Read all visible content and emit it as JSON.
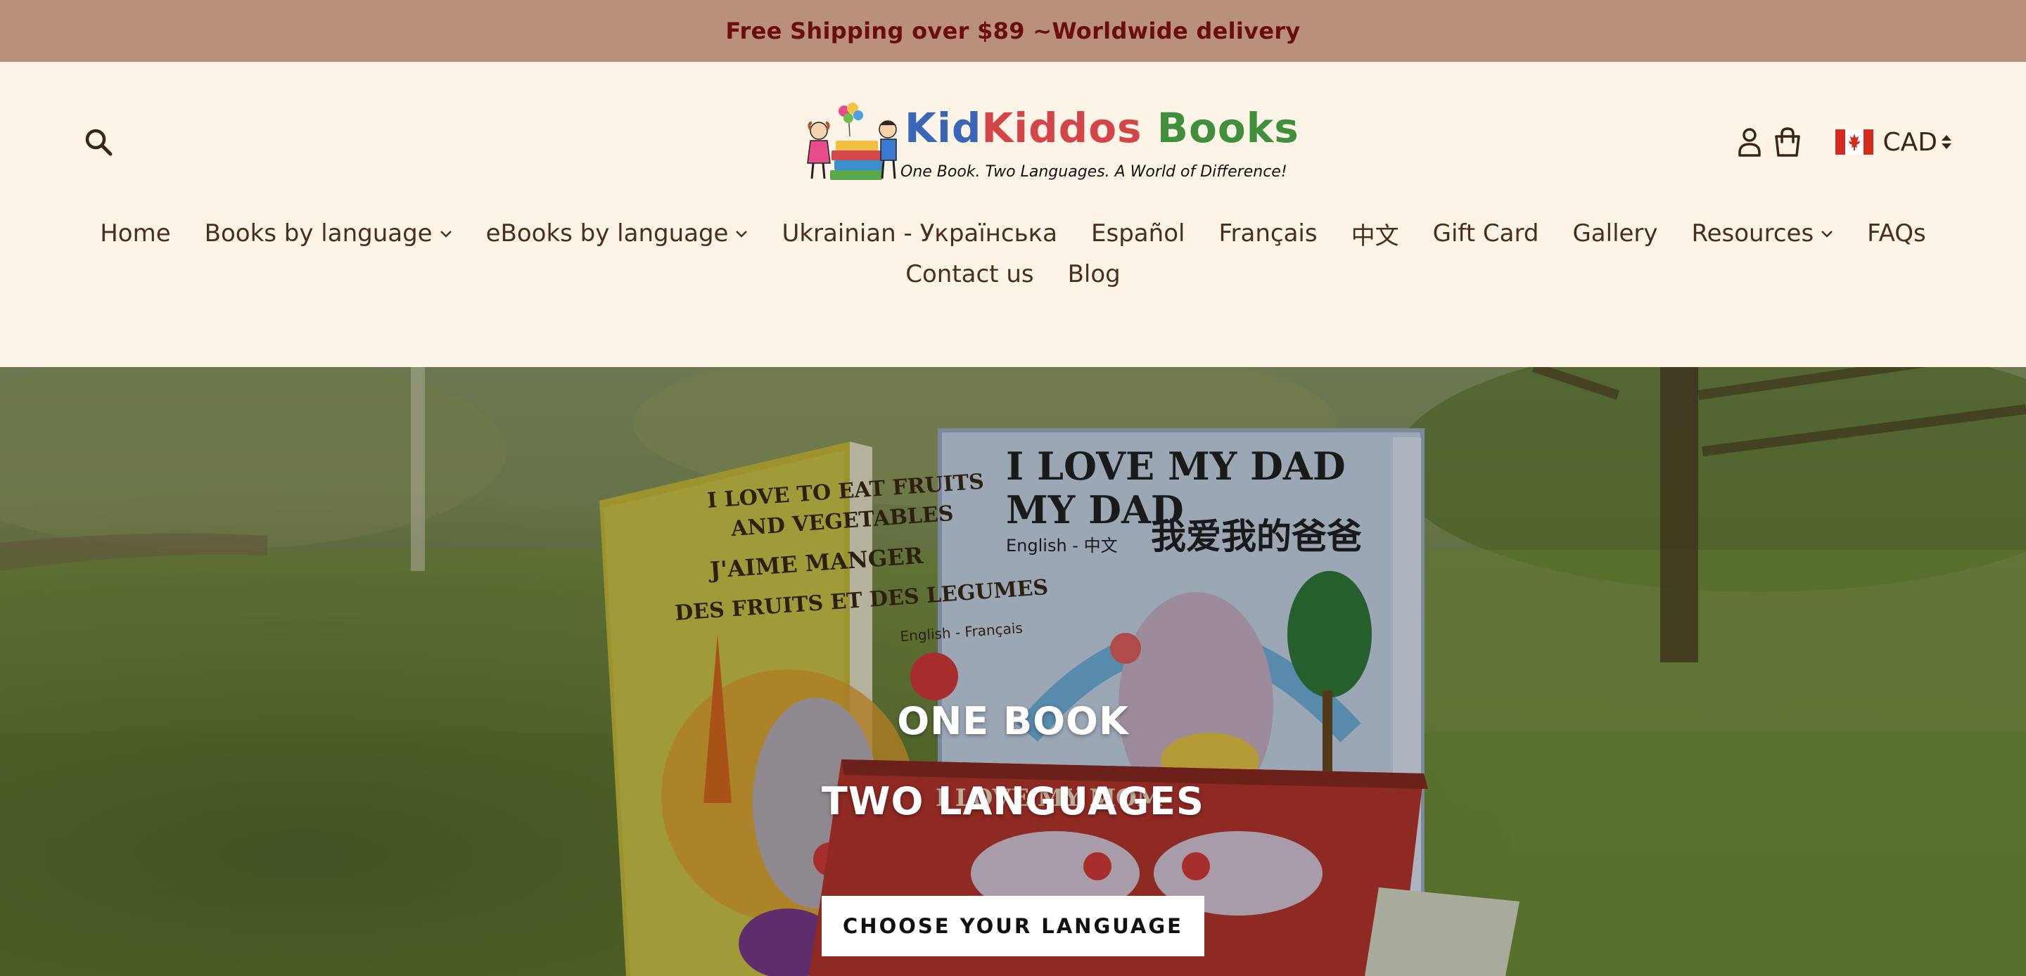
{
  "announcement": {
    "text": "Free Shipping over $89 ~Worldwide delivery",
    "background": "#b8907c",
    "color": "#6b0d0d"
  },
  "header": {
    "logo": {
      "wordmark_kid": "Kid",
      "wordmark_kiddos": "Kiddos",
      "wordmark_books": "Books",
      "tagline": "One Book. Two Languages. A World of Difference!"
    },
    "icons": {
      "search": "search-icon",
      "account": "account-icon",
      "cart": "cart-icon",
      "flag": "canada-flag-icon"
    },
    "currency": "CAD"
  },
  "nav": {
    "items": [
      {
        "label": "Home",
        "dropdown": false
      },
      {
        "label": "Books by language",
        "dropdown": true
      },
      {
        "label": "eBooks by language",
        "dropdown": true
      },
      {
        "label": "Ukrainian - Українська",
        "dropdown": false
      },
      {
        "label": "Español",
        "dropdown": false
      },
      {
        "label": "Français",
        "dropdown": false
      },
      {
        "label": "中文",
        "dropdown": false
      },
      {
        "label": "Gift Card",
        "dropdown": false
      },
      {
        "label": "Gallery",
        "dropdown": false
      },
      {
        "label": "Resources",
        "dropdown": true
      },
      {
        "label": "FAQs",
        "dropdown": false
      },
      {
        "label": "Contact us",
        "dropdown": false
      },
      {
        "label": "Blog",
        "dropdown": false
      }
    ]
  },
  "hero": {
    "line1": "ONE BOOK",
    "line2": "TWO LANGUAGES",
    "cta": "CHOOSE YOUR LANGUAGE",
    "book_green_title_en": "I LOVE TO EAT FRUITS AND VEGETABLES",
    "book_green_title_fr": "J'AIME MANGER DES FRUITS ET DES LEGUMES",
    "book_green_langs": "English - Français",
    "book_blue_title_en": "I LOVE MY DAD",
    "book_blue_title_zh": "我爱我的爸爸",
    "book_blue_langs": "English - 中文",
    "book_red_title": "I LOVE MY MOM"
  },
  "colors": {
    "page_bg": "#fcf4e6",
    "nav_text": "#4a2e1c",
    "icon_color": "#3a2616"
  }
}
